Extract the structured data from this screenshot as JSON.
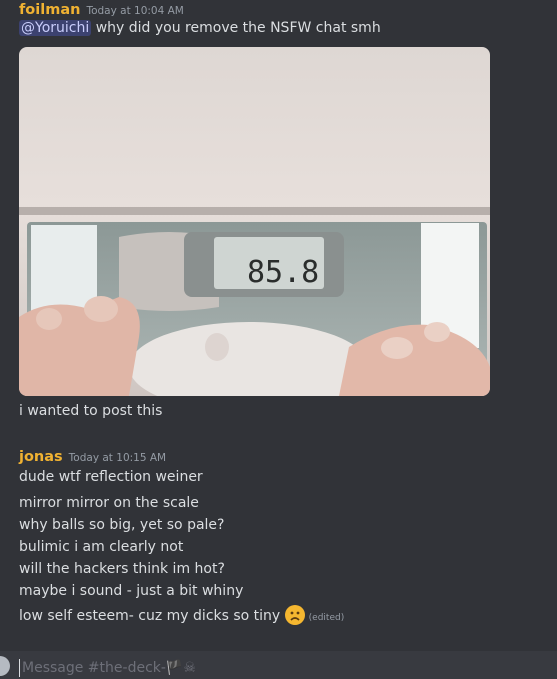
{
  "messages": [
    {
      "author": "foilman",
      "timestamp": "Today at 10:04 AM",
      "mention": "@Yoruichi",
      "text": "why did you remove the NSFW chat smh",
      "caption": "i wanted to post this"
    },
    {
      "author": "jonas",
      "timestamp": "Today at 10:15 AM",
      "lines": [
        "dude  wtf reflection weiner",
        "mirror mirror on the scale",
        "why balls so big, yet so pale?",
        "bulimic i am clearly not",
        "will the hackers think im hot?",
        "maybe i sound - just a bit whiny",
        "low self esteem- cuz my dicks so tiny"
      ],
      "edited_label": "(edited)",
      "emoji": "frowning-face-emoji"
    }
  ],
  "scale_display": "85.8",
  "composer": {
    "placeholder": "Message #the-deck-🏴☠"
  }
}
